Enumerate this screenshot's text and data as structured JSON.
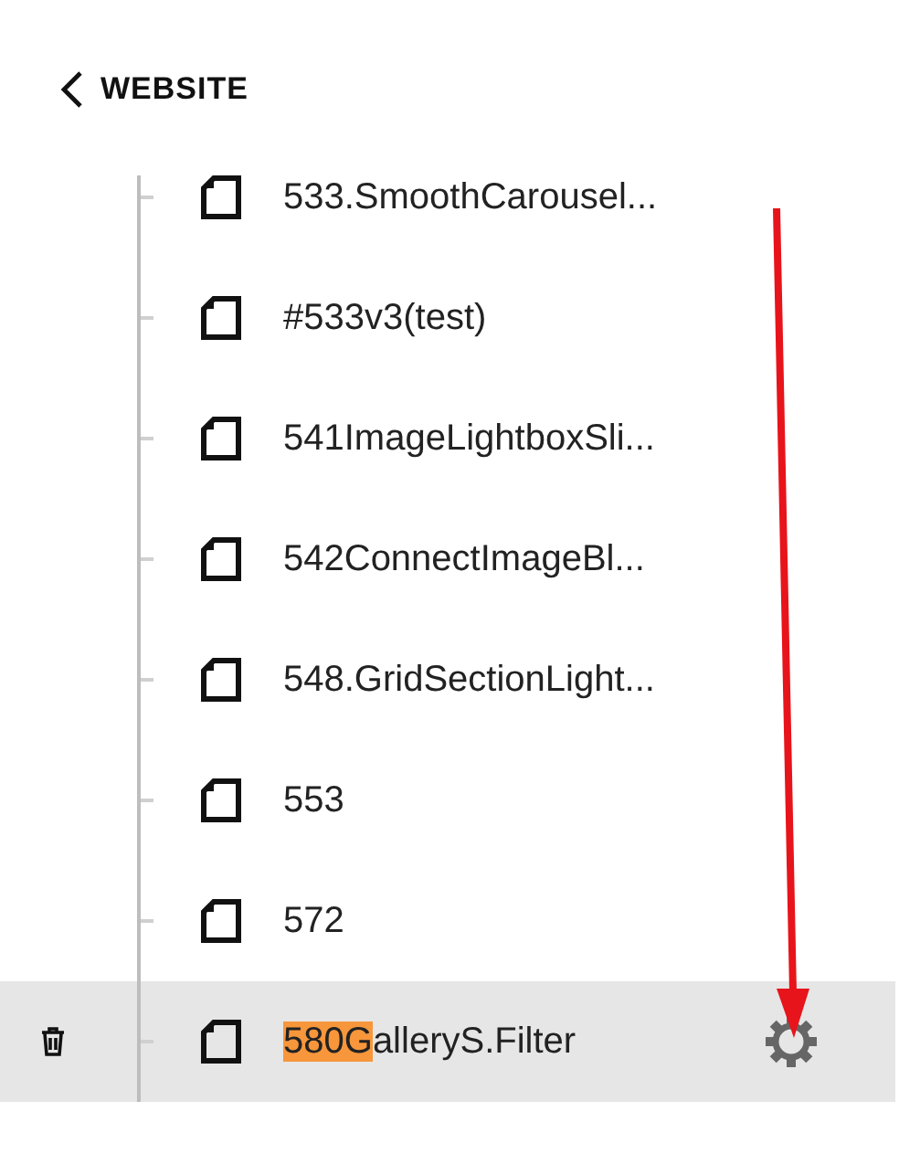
{
  "header": {
    "back_label": "WEBSITE"
  },
  "pages": [
    {
      "label": "533.SmoothCarousel...",
      "selected": false
    },
    {
      "label": "#533v3(test)",
      "selected": false
    },
    {
      "label": "541ImageLightboxSli...",
      "selected": false
    },
    {
      "label": "542ConnectImageBl...",
      "selected": false
    },
    {
      "label": "548.GridSectionLight...",
      "selected": false
    },
    {
      "label": "553",
      "selected": false
    },
    {
      "label": "572",
      "selected": false
    },
    {
      "highlight": "580G",
      "label": "alleryS.Filter",
      "selected": true
    }
  ]
}
